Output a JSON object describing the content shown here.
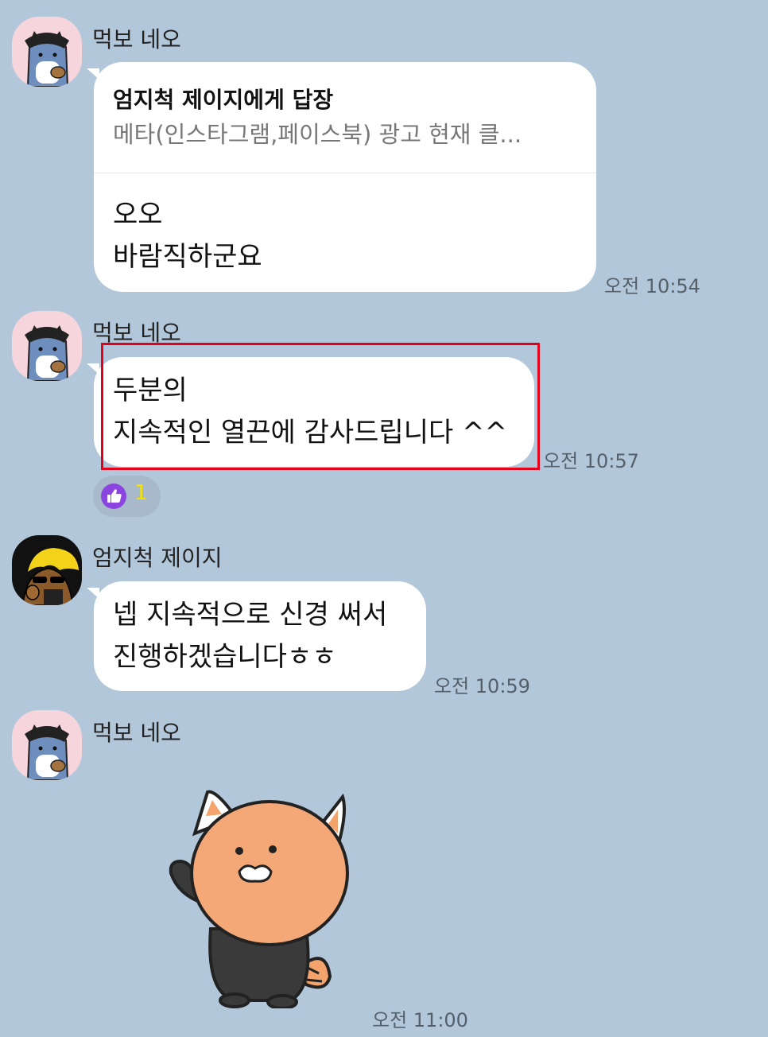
{
  "messages": [
    {
      "sender": "먹보 네오",
      "reply": {
        "to": "엄지척 제이지에게 답장",
        "quote": "메타(인스타그램,페이스북) 광고 현재 클..."
      },
      "lines": [
        "오오",
        "바람직하군요"
      ],
      "time": "오전 10:54"
    },
    {
      "sender": "먹보 네오",
      "lines": [
        "두분의",
        "지속적인 열끈에 감사드립니다 ^^"
      ],
      "time": "오전 10:57",
      "reaction": {
        "icon": "thumbs-up-icon",
        "count": "1"
      }
    },
    {
      "sender": "엄지척 제이지",
      "lines": [
        "넵 지속적으로 신경 써서",
        "진행하겠습니다ㅎㅎ"
      ],
      "time": "오전 10:59"
    },
    {
      "sender": "먹보 네오",
      "sticker": "waving-cat-sticker",
      "time": "오전 11:00"
    }
  ],
  "colors": {
    "background": "#b2c7da",
    "bubble": "#ffffff",
    "highlight_border": "#e3001b",
    "reaction_icon": "#8b44e0",
    "reaction_count": "#f5e100",
    "time_text": "#55606b"
  }
}
